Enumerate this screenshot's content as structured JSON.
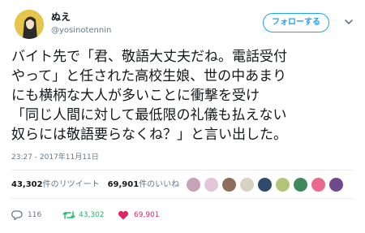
{
  "user": {
    "display_name": "ぬえ",
    "username": "@yosinotennin"
  },
  "follow_button": "フォローする",
  "tweet": {
    "lines": [
      "バイト先で「君、敬語大丈夫だね。電話受付",
      "やって」と任された高校生娘、世の中あまり",
      "にも横柄な大人が多いことに衝撃を受け",
      "「同じ人間に対して最低限の礼儀も払えない",
      "奴らには敬語要らなくね？」と言い出した。"
    ],
    "timestamp": "23:27 - 2017年11月11日"
  },
  "stats": {
    "retweets_count": "43,302",
    "retweets_label": "件のリツイート",
    "likes_count": "69,901",
    "likes_label": "件のいいね"
  },
  "actions": {
    "reply_count": "116",
    "retweet_count": "43,302",
    "like_count": "69,901"
  },
  "colors": {
    "accent": "#1da1f2",
    "retweet": "#17bf63",
    "like": "#e0245e",
    "muted": "#657786"
  },
  "icons": {
    "reply": "reply-icon",
    "retweet": "retweet-icon",
    "like": "heart-icon",
    "menu": "chevron-down-icon"
  }
}
